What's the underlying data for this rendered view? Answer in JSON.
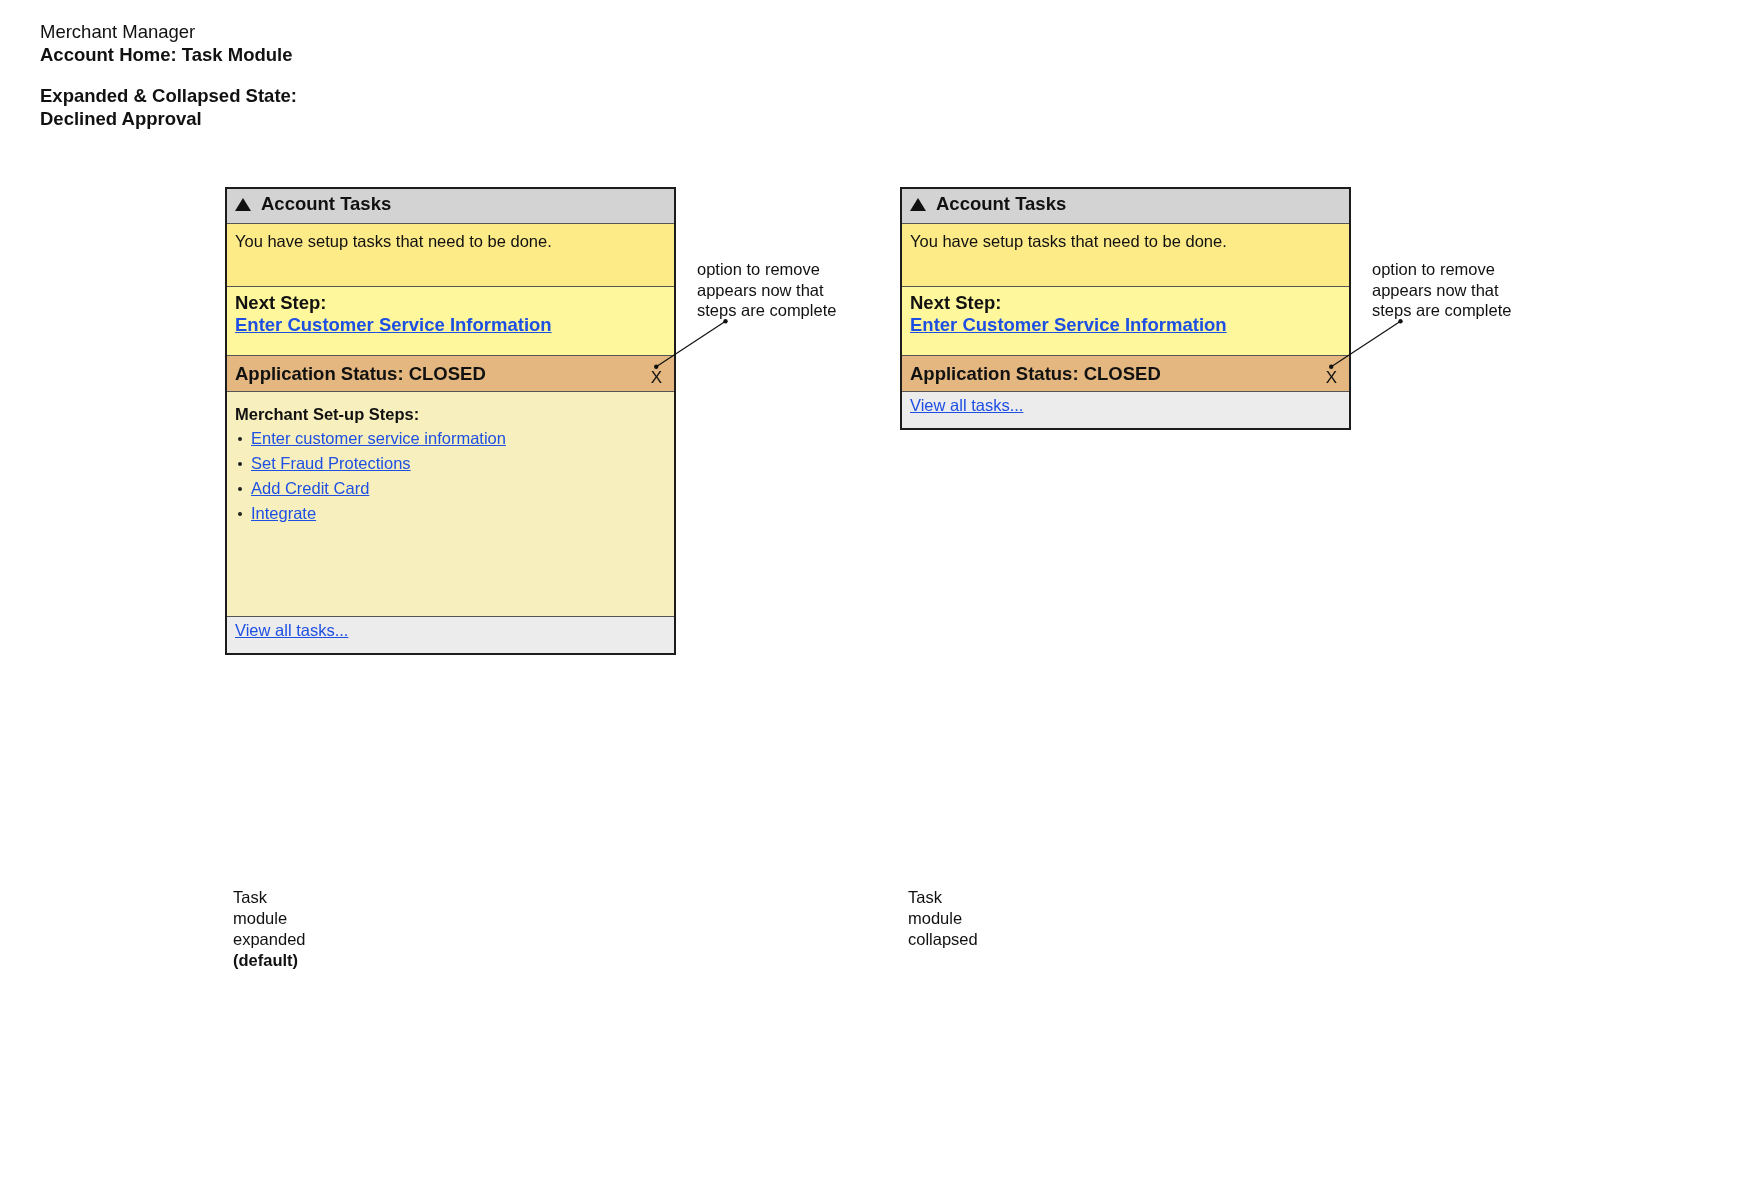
{
  "page_header": {
    "app_name": "Merchant Manager",
    "page_title": "Account Home: Task Module",
    "state_title": "Expanded & Collapsed State:",
    "state_subtitle": "Declined Approval"
  },
  "panels": [
    {
      "card": {
        "expanded": true,
        "title": "Account Tasks",
        "message": "You have setup tasks that need to be done.",
        "next_step": {
          "label": "Next Step:",
          "link": "Enter Customer Service Information"
        },
        "status": {
          "text": "Application Status: CLOSED",
          "remove_button": "X"
        },
        "setup_steps": {
          "title": "Merchant Set-up Steps:",
          "items": [
            "Enter customer service information",
            "Set Fraud Protections",
            "Add Credit Card",
            "Integrate"
          ]
        },
        "footer_link": "View all tasks..."
      },
      "annotation": "option to remove appears now that steps are complete",
      "caption": "Task module expanded **(default)**"
    },
    {
      "card": {
        "expanded": false,
        "title": "Account Tasks",
        "message": "You have setup tasks that need to be done.",
        "next_step": {
          "label": "Next Step:",
          "link": "Enter Customer Service Information"
        },
        "status": {
          "text": "Application Status: CLOSED",
          "remove_button": "X"
        },
        "footer_link": "View all tasks..."
      },
      "annotation": "option to remove appears now that steps are complete",
      "caption": "Task module collapsed"
    }
  ]
}
